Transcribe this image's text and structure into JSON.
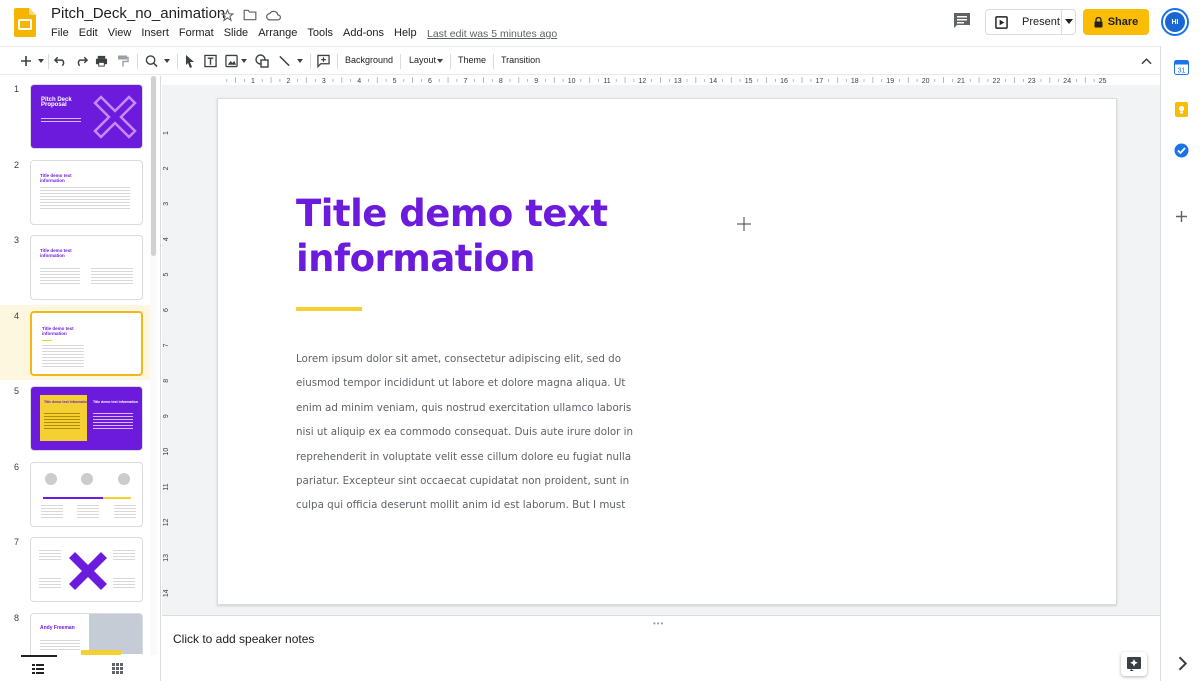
{
  "app": {
    "doc_title": "Pitch_Deck_no_animation",
    "menu": [
      "File",
      "Edit",
      "View",
      "Insert",
      "Format",
      "Slide",
      "Arrange",
      "Tools",
      "Add-ons",
      "Help"
    ],
    "last_edit": "Last edit was 5 minutes ago",
    "present_label": "Present",
    "share_label": "Share",
    "avatar_initials": "HI",
    "accent_color": "#fbbc04",
    "brand_color": "#6c1bdc"
  },
  "toolbar": {
    "background_label": "Background",
    "layout_label": "Layout",
    "theme_label": "Theme",
    "transition_label": "Transition"
  },
  "filmstrip": {
    "slides": [
      {
        "num": "1",
        "title": "Pitch Deck Proposal",
        "style": "purple-cover"
      },
      {
        "num": "2",
        "title": "Title demo text information",
        "style": "text-wide"
      },
      {
        "num": "3",
        "title": "Title demo text information",
        "style": "text-two-col"
      },
      {
        "num": "4",
        "title": "Title demo text information",
        "style": "text-narrow",
        "selected": true
      },
      {
        "num": "5",
        "title": "Title demo text information",
        "style": "purple-yellow"
      },
      {
        "num": "6",
        "title": "",
        "style": "timeline"
      },
      {
        "num": "7",
        "title": "",
        "style": "diagram-x"
      },
      {
        "num": "8",
        "title": "Andy Freeman",
        "style": "profile"
      }
    ],
    "selected_index": 4
  },
  "ruler": {
    "top_numbers": [
      "1",
      "2",
      "3",
      "4",
      "5",
      "6",
      "7",
      "8",
      "9",
      "10",
      "11",
      "12",
      "13",
      "14",
      "15",
      "16",
      "17",
      "18",
      "19",
      "20",
      "21",
      "22",
      "23",
      "24",
      "25"
    ],
    "left_numbers": [
      "1",
      "2",
      "3",
      "4",
      "5",
      "6",
      "7",
      "8",
      "9",
      "10",
      "11",
      "12",
      "13",
      "14"
    ]
  },
  "slide": {
    "title": "Title demo text information",
    "body": "Lorem ipsum dolor sit amet, consectetur adipiscing elit, sed do eiusmod tempor incididunt ut labore et dolore magna aliqua. Ut enim ad minim veniam, quis nostrud exercitation ullamco laboris nisi ut aliquip ex ea commodo consequat. Duis aute irure dolor in reprehenderit in voluptate velit esse cillum dolore eu fugiat nulla pariatur. Excepteur sint occaecat cupidatat non proident, sunt in culpa qui officia deserunt mollit anim id est laborum. But I must",
    "underline_color": "#f5d033"
  },
  "notes": {
    "placeholder": "Click to add speaker notes"
  }
}
